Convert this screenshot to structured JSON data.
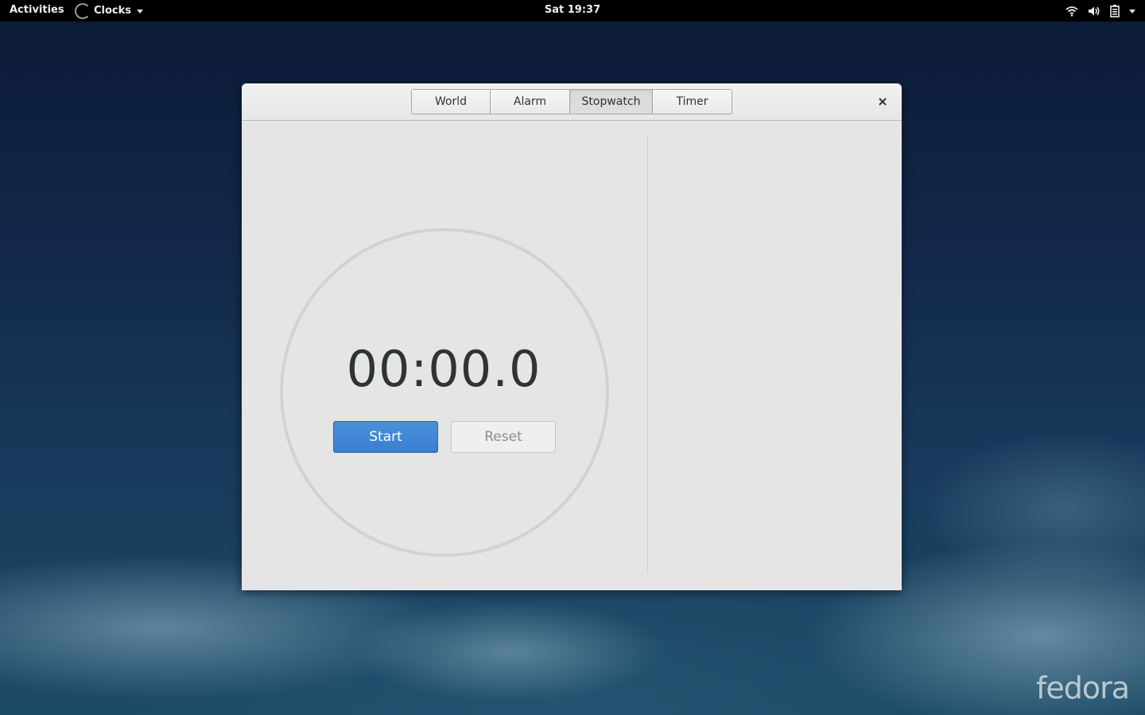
{
  "topbar": {
    "activities": "Activities",
    "app_name": "Clocks",
    "clock": "Sat 19:37",
    "icons": [
      "wifi-icon",
      "volume-icon",
      "battery-icon",
      "system-menu-caret-icon"
    ]
  },
  "window": {
    "tabs": [
      {
        "label": "World",
        "active": false
      },
      {
        "label": "Alarm",
        "active": false
      },
      {
        "label": "Stopwatch",
        "active": true
      },
      {
        "label": "Timer",
        "active": false
      }
    ],
    "close_icon": "close-icon",
    "stopwatch": {
      "time": "00:00.0",
      "start_label": "Start",
      "reset_label": "Reset"
    }
  },
  "desktop": {
    "watermark": "fedora"
  },
  "colors": {
    "accent": "#4a90d9",
    "topbar": "#000000",
    "window_bg": "#e5e5e5"
  }
}
